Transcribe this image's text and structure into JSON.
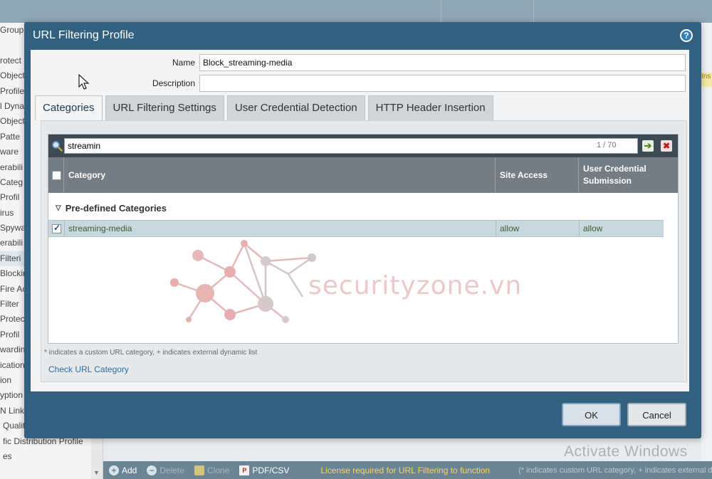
{
  "background": {
    "sidebar_items": [
      "Group",
      "",
      "rotect",
      "Object",
      "Profile",
      "l Dyna",
      "Object",
      "Patte",
      "ware",
      "erabili",
      "Categ",
      "Profil",
      "irus",
      "Spywa",
      "erabili",
      "Filteri",
      "Blockin",
      "Fire Ac",
      "Filter",
      "Protec",
      "Profil",
      "wardin",
      "ication",
      "ion",
      "yption",
      "N Link",
      "Quality Profile",
      "fic Distribution Profile",
      "es"
    ],
    "right_tag": "Ins",
    "toolbar": {
      "add": "Add",
      "delete": "Delete",
      "clone": "Clone",
      "pdf_csv": "PDF/CSV",
      "license": "License required for URL Filtering to function",
      "note": "(* indicates custom URL category, + indicates external dy"
    },
    "windows_watermark": "Activate Windows"
  },
  "dialog": {
    "title": "URL Filtering Profile",
    "help_icon": "?",
    "name_label": "Name",
    "name_value": "Block_streaming-media",
    "description_label": "Description",
    "description_value": "",
    "tabs": [
      {
        "label": "Categories",
        "active": true
      },
      {
        "label": "URL Filtering Settings",
        "active": false
      },
      {
        "label": "User Credential Detection",
        "active": false
      },
      {
        "label": "HTTP Header Insertion",
        "active": false
      }
    ],
    "search": {
      "value": "streamin",
      "count": "1 / 70"
    },
    "columns": {
      "category": "Category",
      "site_access": "Site Access",
      "user_credential": "User Credential Submission"
    },
    "group": "Pre-defined Categories",
    "rows": [
      {
        "checked": true,
        "category": "streaming-media",
        "site_access": "allow",
        "user_credential": "allow"
      }
    ],
    "watermark_text": "securityzone.vn",
    "footnote": "* indicates a custom URL category, + indicates external dynamic list",
    "check_link": "Check URL Category",
    "ok": "OK",
    "cancel": "Cancel"
  },
  "colors": {
    "dialog": "#31617f",
    "header": "#757d84",
    "selected_row": "#c9d7de",
    "link": "#2c6fa6"
  }
}
